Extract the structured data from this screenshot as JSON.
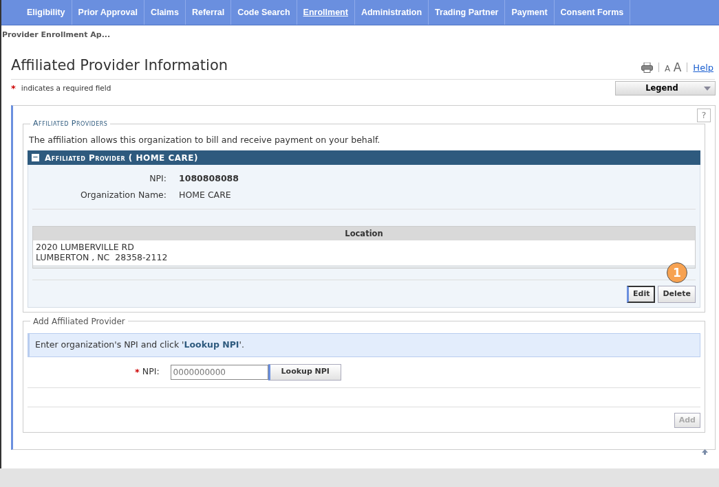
{
  "nav_tabs": [
    {
      "label": "Eligibility",
      "selected": false
    },
    {
      "label": "Prior Approval",
      "selected": false
    },
    {
      "label": "Claims",
      "selected": false
    },
    {
      "label": "Referral",
      "selected": false
    },
    {
      "label": "Code Search",
      "selected": false
    },
    {
      "label": "Enrollment",
      "selected": true
    },
    {
      "label": "Administration",
      "selected": false
    },
    {
      "label": "Trading Partner",
      "selected": false
    },
    {
      "label": "Payment",
      "selected": false
    },
    {
      "label": "Consent Forms",
      "selected": false
    }
  ],
  "breadcrumb": "Provider Enrollment Ap...",
  "page_title": "Affiliated Provider Information",
  "font_size_label": [
    "A",
    "A"
  ],
  "help_link": "Help",
  "required_note": {
    "mark": "*",
    "text": "indicates a required field"
  },
  "legend_dropdown": "Legend",
  "help_button": "?",
  "affiliated_section": {
    "legend": "Affiliated Providers",
    "description": "The affiliation allows this organization to bill and receive payment on your behalf.",
    "provider": {
      "toggle": "−",
      "title": "Affiliated Provider ( HOME CARE)",
      "fields": [
        {
          "label": "NPI:",
          "value": "1080808088",
          "bold": true
        },
        {
          "label": "Organization Name:",
          "value": "HOME CARE",
          "bold": false
        }
      ],
      "location_column": "Location",
      "location_lines": [
        "2020 LUMBERVILLE RD",
        "LUMBERTON , NC  28358-2112"
      ],
      "buttons": [
        {
          "label": "Edit",
          "focused": true
        },
        {
          "label": "Delete",
          "focused": false
        }
      ],
      "callout": "1"
    }
  },
  "add_section": {
    "legend": "Add Affiliated Provider",
    "instruction": "Enter organization's NPI and click '**Lookup NPI**'.",
    "npi_label": "NPI:",
    "required_mark": "*",
    "npi_placeholder": "0000000000",
    "lookup_button": "Lookup NPI",
    "add_button": {
      "label": "Add",
      "disabled": true
    }
  }
}
